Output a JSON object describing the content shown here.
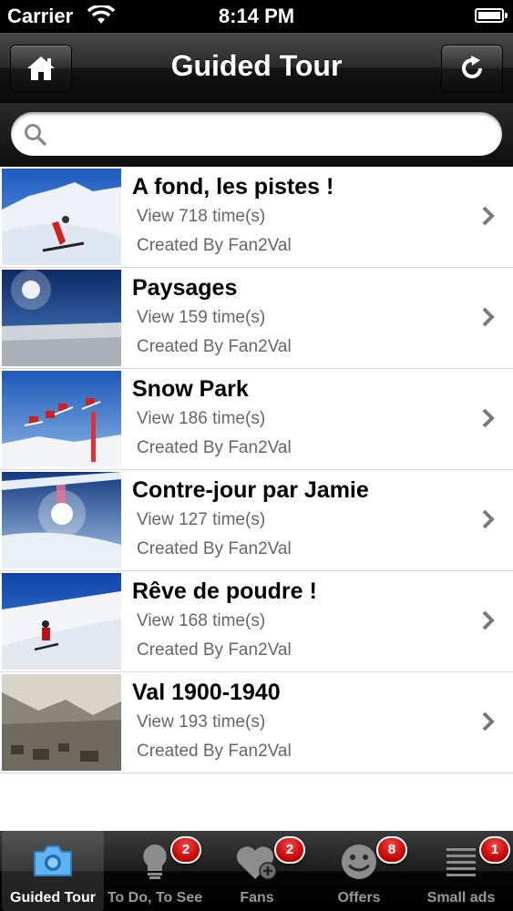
{
  "status_bar": {
    "carrier": "Carrier",
    "time": "8:14 PM"
  },
  "nav": {
    "title": "Guided Tour",
    "left_icon": "home-icon",
    "right_icon": "refresh-icon"
  },
  "search": {
    "placeholder": "",
    "value": ""
  },
  "tours": [
    {
      "name": "A fond, les pistes !",
      "views": "View 718  time(s)",
      "creator": "Created By Fan2Val"
    },
    {
      "name": "Paysages",
      "views": "View 159  time(s)",
      "creator": "Created By Fan2Val"
    },
    {
      "name": "Snow Park",
      "views": "View 186  time(s)",
      "creator": "Created By Fan2Val"
    },
    {
      "name": "Contre-jour par Jamie",
      "views": "View 127  time(s)",
      "creator": "Created By Fan2Val"
    },
    {
      "name": "Rêve de poudre !",
      "views": "View 168  time(s)",
      "creator": "Created By Fan2Val"
    },
    {
      "name": "Val 1900-1940",
      "views": "View 193  time(s)",
      "creator": "Created By Fan2Val"
    }
  ],
  "tabs": [
    {
      "label": "Guided Tour",
      "icon": "camera-icon",
      "badge": "",
      "selected": true
    },
    {
      "label": "To Do, To See",
      "icon": "lightbulb-icon",
      "badge": "2",
      "selected": false
    },
    {
      "label": "Fans",
      "icon": "heart-plus-icon",
      "badge": "2",
      "selected": false
    },
    {
      "label": "Offers",
      "icon": "smiley-icon",
      "badge": "8",
      "selected": false
    },
    {
      "label": "Small ads",
      "icon": "list-icon",
      "badge": "1",
      "selected": false
    }
  ],
  "colors": {
    "badge": "#d10000",
    "nav_bg": "#1a1a1a",
    "accent_tab": "#5fb3f0"
  }
}
